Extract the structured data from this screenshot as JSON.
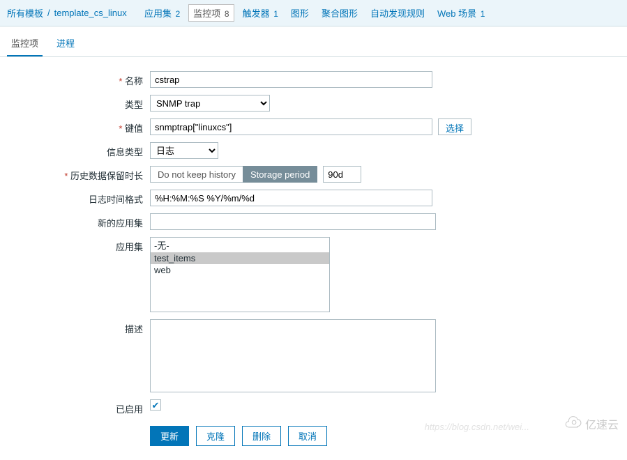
{
  "breadcrumb": {
    "all_templates": "所有模板",
    "template_name": "template_cs_linux",
    "items": [
      {
        "label": "应用集",
        "count": "2"
      },
      {
        "label": "监控项",
        "count": "8"
      },
      {
        "label": "触发器",
        "count": "1"
      },
      {
        "label": "图形",
        "count": ""
      },
      {
        "label": "聚合图形",
        "count": ""
      },
      {
        "label": "自动发现规则",
        "count": ""
      },
      {
        "label": "Web 场景",
        "count": "1"
      }
    ]
  },
  "tabs": {
    "monitor": "监控项",
    "process": "进程"
  },
  "form": {
    "name_label": "名称",
    "name_value": "cstrap",
    "type_label": "类型",
    "type_value": "SNMP trap",
    "key_label": "键值",
    "key_value": "snmptrap[\"linuxcs\"]",
    "select_btn": "选择",
    "info_type_label": "信息类型",
    "info_type_value": "日志",
    "history_label": "历史数据保留时长",
    "history_no_keep": "Do not keep history",
    "history_storage": "Storage period",
    "history_value": "90d",
    "log_format_label": "日志时间格式",
    "log_format_value": "%H:%M:%S %Y/%m/%d",
    "new_app_label": "新的应用集",
    "apps_label": "应用集",
    "app_options": [
      "-无-",
      "test_items",
      "web"
    ],
    "app_selected_index": 1,
    "desc_label": "描述",
    "enabled_label": "已启用",
    "enabled_checked": true
  },
  "actions": {
    "update": "更新",
    "clone": "克隆",
    "delete": "删除",
    "cancel": "取消"
  },
  "watermarks": {
    "csdn": "https://blog.csdn.net/wei...",
    "yisu": "亿速云"
  }
}
